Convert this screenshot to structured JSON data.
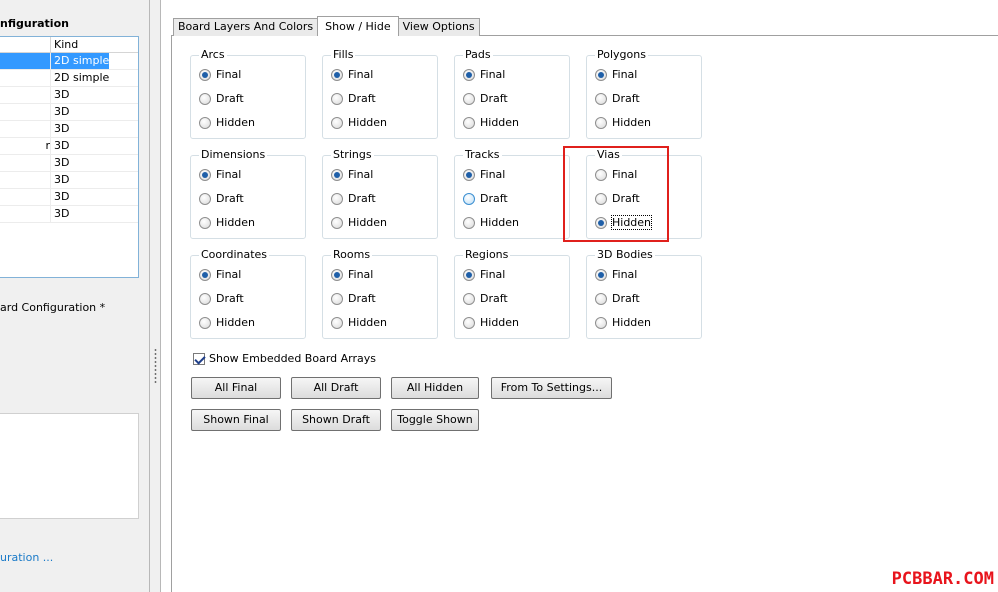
{
  "left": {
    "title": "nfiguration",
    "list_header": {
      "kind": "Kind"
    },
    "rows": [
      {
        "name": "",
        "kind": "2D simple",
        "selected": true
      },
      {
        "name": "",
        "kind": "2D simple",
        "selected": false
      },
      {
        "name": "",
        "kind": "3D",
        "selected": false
      },
      {
        "name": "",
        "kind": "3D",
        "selected": false
      },
      {
        "name": "",
        "kind": "3D",
        "selected": false
      },
      {
        "name": "r",
        "kind": "3D",
        "selected": false
      },
      {
        "name": "",
        "kind": "3D",
        "selected": false
      },
      {
        "name": "",
        "kind": "3D",
        "selected": false
      },
      {
        "name": "",
        "kind": "3D",
        "selected": false
      },
      {
        "name": "",
        "kind": "3D",
        "selected": false
      }
    ],
    "config_label": "ard Configuration *",
    "link": "uration ..."
  },
  "tabs": [
    {
      "label": "Board Layers And Colors",
      "active": false
    },
    {
      "label": "Show / Hide",
      "active": true
    },
    {
      "label": "View Options",
      "active": false
    }
  ],
  "groups": [
    {
      "title": "Arcs",
      "options": [
        "Final",
        "Draft",
        "Hidden"
      ],
      "selected": "Final"
    },
    {
      "title": "Fills",
      "options": [
        "Final",
        "Draft",
        "Hidden"
      ],
      "selected": "Final"
    },
    {
      "title": "Pads",
      "options": [
        "Final",
        "Draft",
        "Hidden"
      ],
      "selected": "Final"
    },
    {
      "title": "Polygons",
      "options": [
        "Final",
        "Draft",
        "Hidden"
      ],
      "selected": "Final"
    },
    {
      "title": "Dimensions",
      "options": [
        "Final",
        "Draft",
        "Hidden"
      ],
      "selected": "Final"
    },
    {
      "title": "Strings",
      "options": [
        "Final",
        "Draft",
        "Hidden"
      ],
      "selected": "Final"
    },
    {
      "title": "Tracks",
      "options": [
        "Final",
        "Draft",
        "Hidden"
      ],
      "selected": "Final",
      "hover": "Draft"
    },
    {
      "title": "Vias",
      "options": [
        "Final",
        "Draft",
        "Hidden"
      ],
      "selected": "Hidden",
      "focus": "Hidden"
    },
    {
      "title": "Coordinates",
      "options": [
        "Final",
        "Draft",
        "Hidden"
      ],
      "selected": "Final"
    },
    {
      "title": "Rooms",
      "options": [
        "Final",
        "Draft",
        "Hidden"
      ],
      "selected": "Final"
    },
    {
      "title": "Regions",
      "options": [
        "Final",
        "Draft",
        "Hidden"
      ],
      "selected": "Final"
    },
    {
      "title": "3D Bodies",
      "options": [
        "Final",
        "Draft",
        "Hidden"
      ],
      "selected": "Final"
    }
  ],
  "show_embedded": {
    "label": "Show Embedded Board Arrays",
    "checked": true
  },
  "buttons": {
    "all_final": "All Final",
    "all_draft": "All Draft",
    "all_hidden": "All Hidden",
    "from_to": "From To Settings...",
    "shown_final": "Shown Final",
    "shown_draft": "Shown Draft",
    "toggle_shown": "Toggle Shown"
  },
  "watermark": "PCBBAR.COM",
  "colors": {
    "highlight": "#e0201c",
    "selection": "#3399ff",
    "watermark": "#e8141c"
  }
}
